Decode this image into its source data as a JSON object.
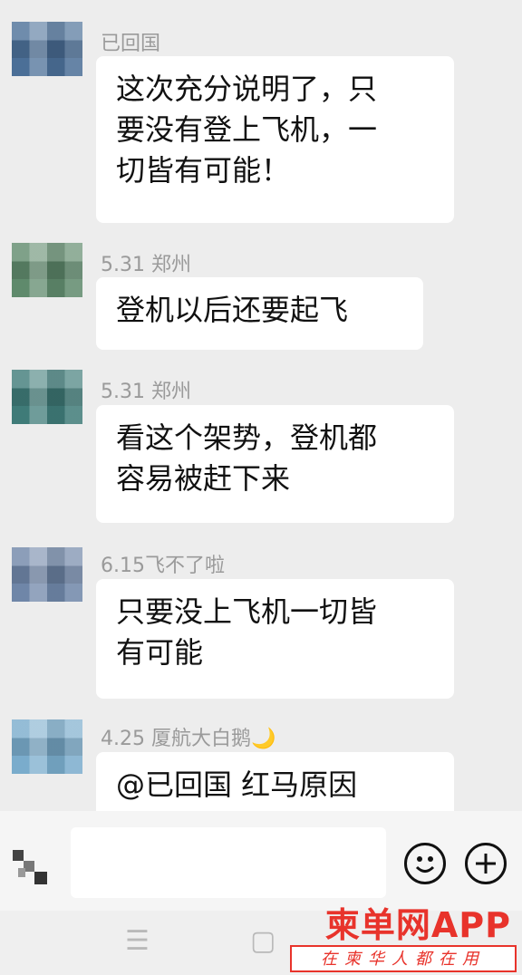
{
  "messages": [
    {
      "sender": "已回国",
      "text": "这次充分说明了，只\n要没有登上飞机，一\n切皆有可能！",
      "avatar_color": "#4b6f97"
    },
    {
      "sender": "5.31  郑州",
      "text": "登机以后还要起飞",
      "avatar_color": "#5f8a6c"
    },
    {
      "sender": "5.31  郑州",
      "text": "看这个架势，登机都\n容易被赶下来",
      "avatar_color": "#3f7b78"
    },
    {
      "sender": "6.15飞不了啦",
      "text": "只要没上飞机一切皆\n有可能",
      "avatar_color": "#6f86a8"
    },
    {
      "sender": "4.25  厦航大白鹅",
      "sender_emoji": "🌙",
      "text": "@已回国  红马原因",
      "avatar_color": "#7aaccc"
    }
  ],
  "input_bar": {
    "emoji_icon": "☺",
    "plus_icon": "+"
  },
  "nav_bar": {
    "menu_icon": "☰",
    "home_icon": "▢"
  },
  "watermark": {
    "brand": "柬单网APP",
    "slogan": "在柬华人都在用"
  },
  "colors": {
    "background": "#ededed",
    "bubble": "#ffffff",
    "brand_red": "#e8332b"
  }
}
